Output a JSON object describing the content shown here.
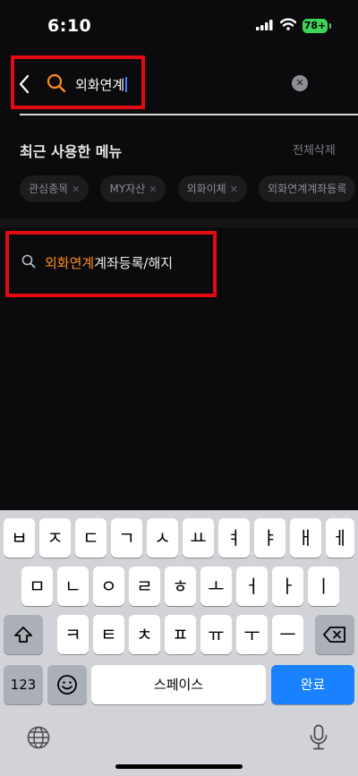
{
  "status": {
    "time": "6:10",
    "battery": "78+"
  },
  "search": {
    "query": "외화연계"
  },
  "recent": {
    "title": "최근 사용한 메뉴",
    "delete_all": "전체삭제",
    "chips": [
      "관심종목",
      "MY자산",
      "외화이체",
      "외화연계계좌등록"
    ]
  },
  "result": {
    "highlight": "외화연계",
    "rest": "계좌등록/해지"
  },
  "keyboard": {
    "row1": [
      "ㅂ",
      "ㅈ",
      "ㄷ",
      "ㄱ",
      "ㅅ",
      "ㅛ",
      "ㅕ",
      "ㅑ",
      "ㅐ",
      "ㅔ"
    ],
    "row2": [
      "ㅁ",
      "ㄴ",
      "ㅇ",
      "ㄹ",
      "ㅎ",
      "ㅗ",
      "ㅓ",
      "ㅏ",
      "ㅣ"
    ],
    "row3": [
      "ㅋ",
      "ㅌ",
      "ㅊ",
      "ㅍ",
      "ㅠ",
      "ㅜ",
      "ㅡ"
    ],
    "num_label": "123",
    "space_label": "스페이스",
    "done_label": "완료"
  },
  "colors": {
    "highlight": "#ff8a1f",
    "annotation_red": "#e50914",
    "done_key": "#1a82ff"
  },
  "icons": [
    "back-chevron-icon",
    "search-icon",
    "clear-icon",
    "shift-icon",
    "backspace-icon",
    "emoji-icon",
    "globe-icon",
    "microphone-icon"
  ]
}
